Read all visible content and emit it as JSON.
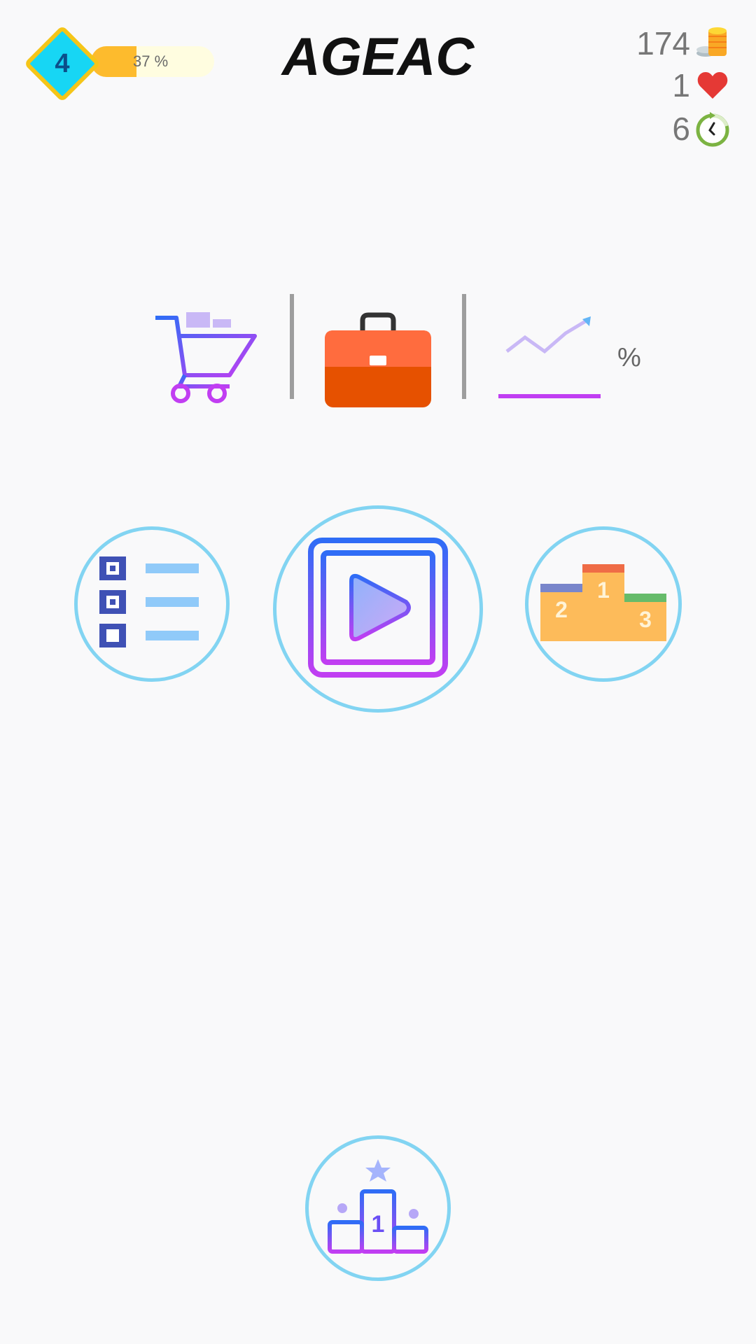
{
  "header": {
    "title": "AGEAC",
    "level": "4",
    "xp_label": "37 %",
    "xp_progress_percent": 37
  },
  "stats": {
    "coins": "174",
    "lives": "1",
    "timer": "6"
  },
  "shop_row": {
    "percent_symbol": "%",
    "icons": [
      "shopping-cart-icon",
      "briefcase-icon",
      "growth-chart-icon"
    ]
  },
  "main_buttons": {
    "left": "checklist-icon",
    "center": "play-icon",
    "right": "podium-icon",
    "bottom": "achievement-podium-icon"
  },
  "colors": {
    "background": "#f9f9fa",
    "circle_border": "#82d4f2",
    "level_diamond": "#17d6f4",
    "level_border": "#f5c518",
    "xp_fill": "#fdbb2d",
    "xp_track": "#fffde0",
    "briefcase": "#ff6c3e",
    "heart": "#e53935"
  }
}
